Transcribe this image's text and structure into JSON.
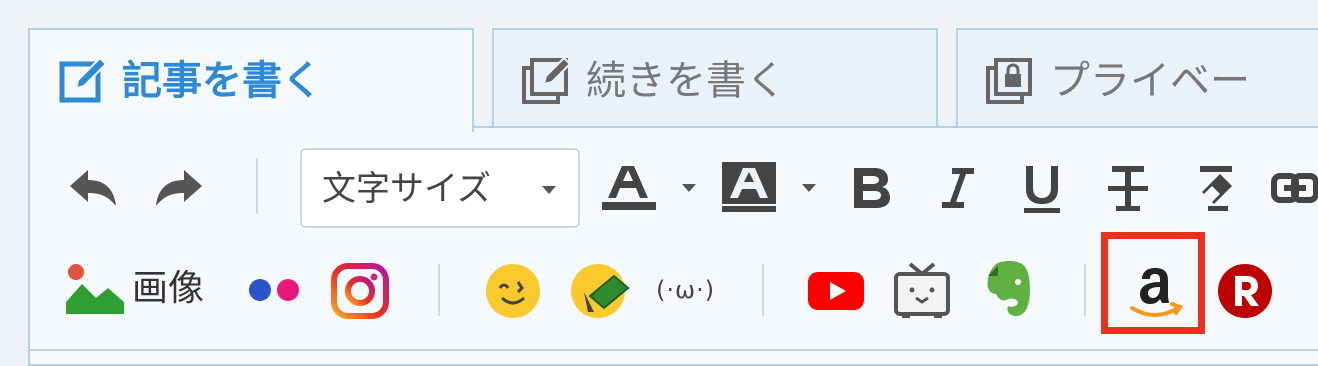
{
  "tabs": [
    {
      "label": "記事を書く",
      "icon": "edit-icon",
      "active": true
    },
    {
      "label": "続きを書く",
      "icon": "continue-edit-icon",
      "active": false
    },
    {
      "label": "プライベー",
      "icon": "private-lock-icon",
      "active": false
    }
  ],
  "toolbar": {
    "undo_icon": "undo-icon",
    "redo_icon": "redo-icon",
    "font_size_select": {
      "value": "文字サイズ"
    },
    "text_color_icon": "text-color-icon",
    "background_color_icon": "background-color-icon",
    "bold_icon": "bold-icon",
    "italic_icon": "italic-icon",
    "underline_icon": "underline-icon",
    "strikethrough_icon": "strikethrough-icon",
    "clear_format_icon": "clear-format-icon",
    "link_icon": "link-icon"
  },
  "insert_bar": {
    "image_label": "画像",
    "kaomoji_label": "(·ω·)",
    "items": [
      "image-icon",
      "flickr-icon",
      "instagram-icon",
      "emoji-icon",
      "emoji-palette-icon",
      "kaomoji-icon",
      "youtube-icon",
      "niconico-icon",
      "evernote-icon",
      "amazon-icon",
      "rakuten-icon"
    ]
  },
  "colors": {
    "accent_blue": "#2e8ad7",
    "highlight_red": "#e8321e",
    "youtube_red": "#ff0000",
    "evernote_green": "#5fb142",
    "rakuten_red": "#bf0000"
  }
}
